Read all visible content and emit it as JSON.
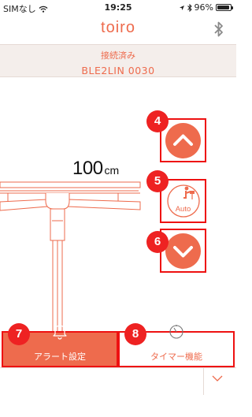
{
  "status_bar": {
    "carrier": "SIMなし",
    "time": "19:25",
    "battery": "96%",
    "battery_level": 0.96
  },
  "header": {
    "logo": "toiro",
    "bluetooth_icon": "bluetooth-icon"
  },
  "connection": {
    "status": "接続済み",
    "device": "BLE2LIN 0030"
  },
  "desk": {
    "height_value": "100",
    "height_unit": "cm"
  },
  "controls": {
    "up_icon": "chevron-up-icon",
    "auto_label": "Auto",
    "down_icon": "chevron-down-icon"
  },
  "markers": [
    "4",
    "5",
    "6",
    "7",
    "8"
  ],
  "tabs": {
    "alert": {
      "label": "アラート設定",
      "icon": "bell-icon"
    },
    "timer": {
      "label": "タイマー機能",
      "icon": "timer-icon"
    }
  },
  "colors": {
    "accent": "#ee6b4d",
    "highlight": "#e11111"
  }
}
